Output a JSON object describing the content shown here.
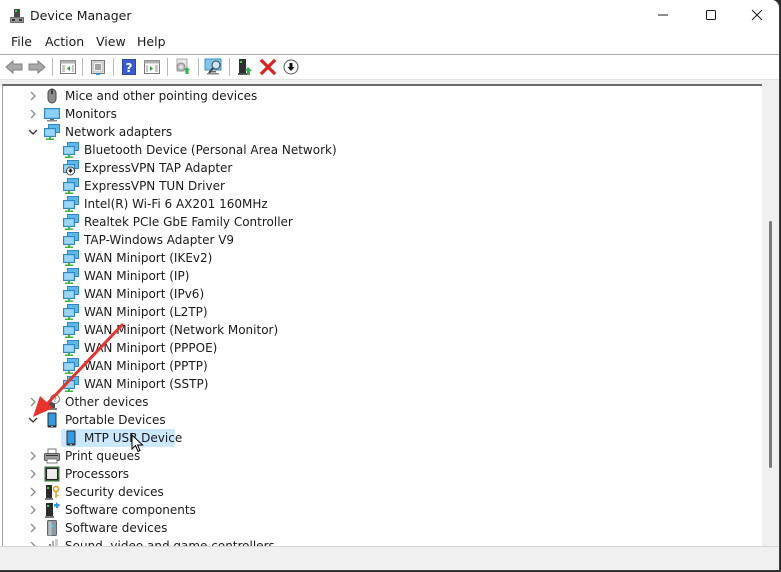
{
  "window": {
    "title": "Device Manager",
    "controls": {
      "minimize": "minimize",
      "maximize": "maximize",
      "close": "close"
    }
  },
  "menu": [
    "File",
    "Action",
    "View",
    "Help"
  ],
  "toolbar": [
    {
      "name": "back-button",
      "icon": "arrow-left-icon",
      "tooltip": "Back"
    },
    {
      "name": "forward-button",
      "icon": "arrow-right-icon",
      "tooltip": "Forward"
    },
    {
      "name": "show-hide-console-tree-button",
      "icon": "console-tree-icon",
      "tooltip": "Show/Hide Console Tree"
    },
    {
      "name": "properties-button",
      "icon": "properties-icon",
      "tooltip": "Properties"
    },
    {
      "name": "help-button",
      "icon": "help-icon",
      "tooltip": "Help"
    },
    {
      "name": "show-hide-action-pane-button",
      "icon": "action-pane-icon",
      "tooltip": "Show/Hide Action Pane"
    },
    {
      "name": "update-driver-button",
      "icon": "update-driver-icon",
      "tooltip": "Update Driver"
    },
    {
      "name": "scan-hardware-button",
      "icon": "scan-monitor-icon",
      "tooltip": "Scan for hardware changes"
    },
    {
      "name": "add-legacy-hardware-button",
      "icon": "add-hardware-icon",
      "tooltip": "Add drivers"
    },
    {
      "name": "uninstall-device-button",
      "icon": "red-x-icon",
      "tooltip": "Uninstall device"
    },
    {
      "name": "disable-device-button",
      "icon": "down-arrow-circle-icon",
      "tooltip": "Disable device"
    }
  ],
  "tree": [
    {
      "label": "Mice and other pointing devices",
      "level": 0,
      "expanded": false,
      "icon": "mouse-icon"
    },
    {
      "label": "Monitors",
      "level": 0,
      "expanded": false,
      "icon": "monitor-icon"
    },
    {
      "label": "Network adapters",
      "level": 0,
      "expanded": true,
      "icon": "network-icon"
    },
    {
      "label": "Bluetooth Device (Personal Area Network)",
      "level": 1,
      "icon": "network-icon"
    },
    {
      "label": "ExpressVPN TAP Adapter",
      "level": 1,
      "icon": "network-disabled-icon"
    },
    {
      "label": "ExpressVPN TUN Driver",
      "level": 1,
      "icon": "network-icon"
    },
    {
      "label": "Intel(R) Wi-Fi 6 AX201 160MHz",
      "level": 1,
      "icon": "network-icon"
    },
    {
      "label": "Realtek PCIe GbE Family Controller",
      "level": 1,
      "icon": "network-icon"
    },
    {
      "label": "TAP-Windows Adapter V9",
      "level": 1,
      "icon": "network-icon"
    },
    {
      "label": "WAN Miniport (IKEv2)",
      "level": 1,
      "icon": "network-icon"
    },
    {
      "label": "WAN Miniport (IP)",
      "level": 1,
      "icon": "network-icon"
    },
    {
      "label": "WAN Miniport (IPv6)",
      "level": 1,
      "icon": "network-icon"
    },
    {
      "label": "WAN Miniport (L2TP)",
      "level": 1,
      "icon": "network-icon"
    },
    {
      "label": "WAN Miniport (Network Monitor)",
      "level": 1,
      "icon": "network-icon"
    },
    {
      "label": "WAN Miniport (PPPOE)",
      "level": 1,
      "icon": "network-icon"
    },
    {
      "label": "WAN Miniport (PPTP)",
      "level": 1,
      "icon": "network-icon"
    },
    {
      "label": "WAN Miniport (SSTP)",
      "level": 1,
      "icon": "network-icon"
    },
    {
      "label": "Other devices",
      "level": 0,
      "expanded": false,
      "icon": "unknown-device-icon"
    },
    {
      "label": "Portable Devices",
      "level": 0,
      "expanded": true,
      "icon": "portable-device-icon"
    },
    {
      "label": "MTP USB Device",
      "level": 1,
      "icon": "portable-device-icon",
      "selected": true
    },
    {
      "label": "Print queues",
      "level": 0,
      "expanded": false,
      "icon": "printer-icon"
    },
    {
      "label": "Processors",
      "level": 0,
      "expanded": false,
      "icon": "processor-icon"
    },
    {
      "label": "Security devices",
      "level": 0,
      "expanded": false,
      "icon": "security-device-icon"
    },
    {
      "label": "Software components",
      "level": 0,
      "expanded": false,
      "icon": "software-component-icon"
    },
    {
      "label": "Software devices",
      "level": 0,
      "expanded": false,
      "icon": "software-device-icon"
    },
    {
      "label": "Sound, video and game controllers",
      "level": 0,
      "expanded": false,
      "icon": "sound-icon"
    }
  ],
  "annotation": {
    "type": "arrow",
    "color": "#e8322e",
    "points_to": "Portable Devices expand chevron"
  },
  "colors": {
    "selection": "#cce8ff",
    "network_icon_blue": "#2f9be0",
    "network_icon_green": "#3db33d"
  }
}
